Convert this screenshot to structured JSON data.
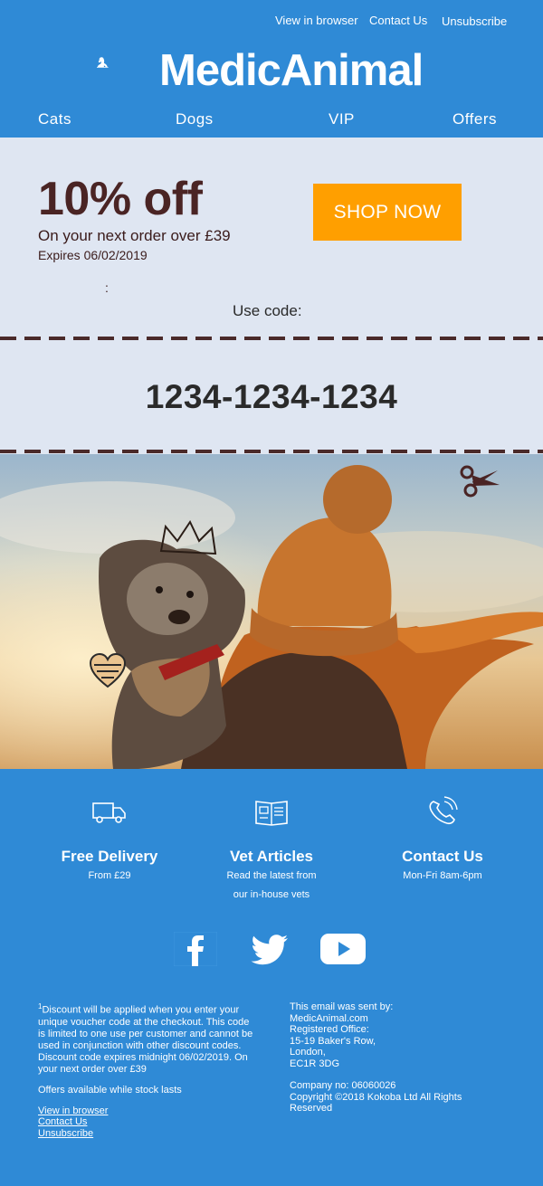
{
  "header": {
    "view_in_browser": "View in browser",
    "contact_us": "Contact Us",
    "unsubscribe": "Unsubscribe",
    "logo_text": "MedicAnimal"
  },
  "nav": {
    "items": [
      "Cats",
      "Dogs",
      "VIP",
      "Offers"
    ]
  },
  "offer": {
    "discount": "10% off",
    "subtitle": "On your next order over £39",
    "expires": "Expires 06/02/2019",
    "colon": ":",
    "button": "SHOP NOW",
    "use_code": "Use code:",
    "code": "1234-1234-1234"
  },
  "features": [
    {
      "title": "Free Delivery",
      "line1": "From £29",
      "line2": "",
      "icon": "truck-icon"
    },
    {
      "title": "Vet Articles",
      "line1": "Read the latest from",
      "line2": "our in-house vets",
      "icon": "article-icon"
    },
    {
      "title": "Contact Us",
      "line1": "Mon-Fri 8am-6pm",
      "line2": "",
      "icon": "phone-icon"
    }
  ],
  "social": [
    "facebook-icon",
    "twitter-icon",
    "youtube-icon"
  ],
  "legal": {
    "sup": "1",
    "discount_note": "Discount will be applied when you enter your unique voucher code at the checkout. This code is limited to one use per customer and cannot be used in conjunction with other discount codes. Discount code expires midnight 06/02/2019. On your next order over £39",
    "stock_note": "Offers available while stock lasts",
    "links": [
      "View in browser",
      "Contact Us",
      "Unsubscribe"
    ]
  },
  "company": {
    "sent_by": "This email was sent by:",
    "site": "MedicAnimal.com",
    "registered": "Registered Office:",
    "addr1": "15-19 Baker's Row,",
    "addr2": "London,",
    "addr3": "EC1R 3DG",
    "company_no": "Company no: 06060026",
    "copyright": "Copyright ©2018 Kokoba Ltd All Rights Reserved"
  },
  "colors": {
    "brand_blue": "#2f8ad6",
    "panel_bg": "#dfe6f2",
    "accent_orange": "#ff9f00",
    "discount_brown": "#4a2424"
  }
}
